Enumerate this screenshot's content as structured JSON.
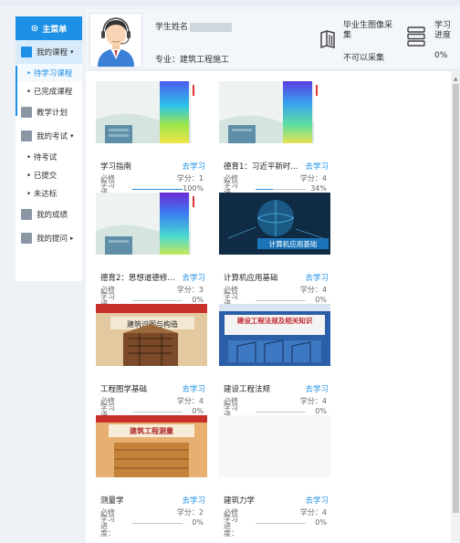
{
  "sidebar": {
    "header": "主菜单",
    "items": [
      {
        "label": "我的课程",
        "arrow": "▾"
      },
      {
        "label": "教学计划"
      },
      {
        "label": "我的考试",
        "arrow": "▾"
      },
      {
        "label": "我的成绩"
      },
      {
        "label": "我的提问",
        "arrow": "▸"
      }
    ],
    "course_subs": [
      "• 待学习课程",
      "• 已完成课程"
    ],
    "exam_subs": [
      "• 待考试",
      "• 已提交",
      "• 未达标"
    ]
  },
  "header": {
    "name_label": "学生姓名",
    "major": "专业：建筑工程施工",
    "graduate_collect": "毕业生图像采集",
    "graduate_status": "不可以采集",
    "progress_label": "学习进度",
    "progress_value": "0%"
  },
  "courses": [
    {
      "title": "学习指南",
      "go": "去学习",
      "required": "必修",
      "credit": "学分：1",
      "progress_label": "学习进度：",
      "progress": "100%",
      "fraction": 1.0
    },
    {
      "title": "德育1：习近平新时...",
      "go": "去学习",
      "required": "必修",
      "credit": "学分：4",
      "progress_label": "学习进度：",
      "progress": "34%",
      "fraction": 0.34
    },
    {
      "title": "德育2：思想道德修...",
      "go": "去学习",
      "required": "必修",
      "credit": "学分：3",
      "progress_label": "学习进度：",
      "progress": "0%",
      "fraction": 0
    },
    {
      "title": "计算机应用基础",
      "go": "去学习",
      "required": "必修",
      "credit": "学分：4",
      "progress_label": "学习进度：",
      "progress": "0%",
      "fraction": 0
    },
    {
      "title": "工程图学基础",
      "go": "去学习",
      "required": "必修",
      "credit": "学分：4",
      "progress_label": "学习进度：",
      "progress": "0%",
      "fraction": 0
    },
    {
      "title": "建设工程法规",
      "go": "去学习",
      "required": "必修",
      "credit": "学分：4",
      "progress_label": "学习进度：",
      "progress": "0%",
      "fraction": 0
    },
    {
      "title": "测量学",
      "go": "去学习",
      "required": "必修",
      "credit": "学分：2",
      "progress_label": "学习进度：",
      "progress": "0%",
      "fraction": 0
    },
    {
      "title": "建筑力学",
      "go": "去学习",
      "required": "必修",
      "credit": "学分：4",
      "progress_label": "学习进度：",
      "progress": "0%",
      "fraction": 0
    }
  ],
  "thumb_texts": {
    "computer": "计算机应用基础",
    "drawing": "建筑识图与构造",
    "law": "建设工程法规及相关知识",
    "survey": "建筑工程测量"
  },
  "colors": {
    "accent": "#1e90e6",
    "active_bg": "#d8ebfb"
  },
  "icons": {
    "menu": "home-icon",
    "course": "course-icon",
    "plan": "plan-icon",
    "exam": "exam-icon",
    "grade": "grade-icon",
    "question": "question-icon"
  }
}
